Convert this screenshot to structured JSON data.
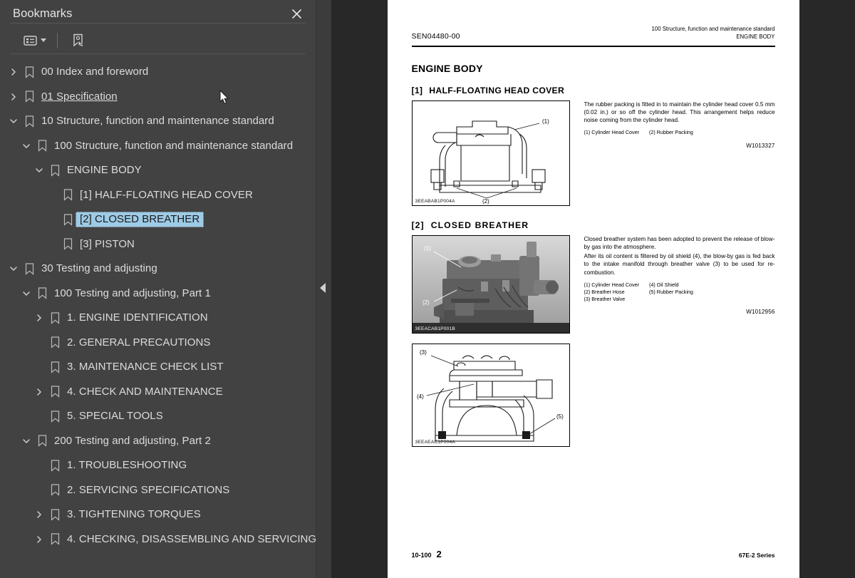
{
  "sidebar": {
    "title": "Bookmarks",
    "close_icon": "close-icon",
    "toolbar": {
      "options_label": "options-list-icon",
      "new_bookmark_label": "new-bookmark-icon"
    },
    "items": [
      {
        "label": "00 Index and foreword",
        "depth": 0,
        "state": "collapsed"
      },
      {
        "label": "01 Specification",
        "depth": 0,
        "state": "collapsed",
        "hover": true
      },
      {
        "label": "10 Structure, function and maintenance standard",
        "depth": 0,
        "state": "expanded"
      },
      {
        "label": "100 Structure, function and maintenance standard",
        "depth": 1,
        "state": "expanded"
      },
      {
        "label": "ENGINE BODY",
        "depth": 2,
        "state": "expanded"
      },
      {
        "label": "[1] HALF-FLOATING HEAD COVER",
        "depth": 3,
        "state": "leaf"
      },
      {
        "label": "[2] CLOSED BREATHER",
        "depth": 3,
        "state": "leaf",
        "selected": true
      },
      {
        "label": "[3] PISTON",
        "depth": 3,
        "state": "leaf"
      },
      {
        "label": "30 Testing and adjusting",
        "depth": 0,
        "state": "expanded"
      },
      {
        "label": "100 Testing and adjusting, Part 1",
        "depth": 1,
        "state": "expanded"
      },
      {
        "label": "1. ENGINE IDENTIFICATION",
        "depth": 2,
        "state": "collapsed"
      },
      {
        "label": "2. GENERAL PRECAUTIONS",
        "depth": 2,
        "state": "leaf"
      },
      {
        "label": "3. MAINTENANCE CHECK LIST",
        "depth": 2,
        "state": "leaf"
      },
      {
        "label": "4. CHECK AND MAINTENANCE",
        "depth": 2,
        "state": "collapsed"
      },
      {
        "label": "5. SPECIAL TOOLS",
        "depth": 2,
        "state": "leaf"
      },
      {
        "label": "200 Testing and adjusting, Part 2",
        "depth": 1,
        "state": "expanded"
      },
      {
        "label": "1. TROUBLESHOOTING",
        "depth": 2,
        "state": "leaf"
      },
      {
        "label": "2. SERVICING SPECIFICATIONS",
        "depth": 2,
        "state": "leaf"
      },
      {
        "label": "3. TIGHTENING TORQUES",
        "depth": 2,
        "state": "collapsed"
      },
      {
        "label": "4. CHECKING, DISASSEMBLING AND SERVICING",
        "depth": 2,
        "state": "collapsed"
      }
    ]
  },
  "splitter": {
    "collapse_icon": "collapse-panel-arrow-icon"
  },
  "document": {
    "header": {
      "sen": "SEN04480-00",
      "right_line1": "100 Structure, function and maintenance standard",
      "right_line2": "ENGINE BODY"
    },
    "section_title": "ENGINE BODY",
    "sections": [
      {
        "num": "[1]",
        "title": "HALF-FLOATING HEAD COVER",
        "figure_caption": "3EEABAB1P004A",
        "figure_type": "line-drawing",
        "paragraphs": [
          "The rubber packing is fitted in to maintain the cylinder head cover 0.5 mm (0.02 in.) or so off the cylinder head.  This arrangement helps reduce noise coming from the cylinder head."
        ],
        "legend_col1": [
          "(1)  Cylinder Head Cover"
        ],
        "legend_col2": [
          "(2)  Rubber Packing"
        ],
        "wnum": "W1013327",
        "callouts": [
          "(1)",
          "(2)"
        ]
      },
      {
        "num": "[2]",
        "title": "CLOSED  BREATHER",
        "figure_caption": "3EEACAB1P001B",
        "figure_type": "photo",
        "paragraphs": [
          "Closed breather system has been adopted to prevent the release of blow-by gas into the atmosphere.",
          "After its oil content is filtered by oil shield (4), the blow-by gas is fed back to the intake manifold through breather valve (3) to be used for re-combustion."
        ],
        "legend_col1": [
          "(1)  Cylinder Head Cover",
          "(2)  Breather Hose",
          "(3)  Breather Valve"
        ],
        "legend_col2": [
          "(4)  Oil Shield",
          "(5)  Rubber Packing"
        ],
        "wnum": "W1012956",
        "callouts": [
          "(1)",
          "(2)"
        ]
      }
    ],
    "figure3": {
      "caption": "3EEAEAC1P004A",
      "callouts": [
        "(3)",
        "(4)",
        "(5)"
      ]
    },
    "footer": {
      "section": "10-100",
      "page": "2",
      "series": "67E-2 Series"
    }
  },
  "colors": {
    "sidebar_bg": "#424242",
    "viewer_bg": "#282828",
    "selection": "#9ecbe6",
    "text": "#dcdcdc",
    "page_bg": "#ffffff"
  }
}
